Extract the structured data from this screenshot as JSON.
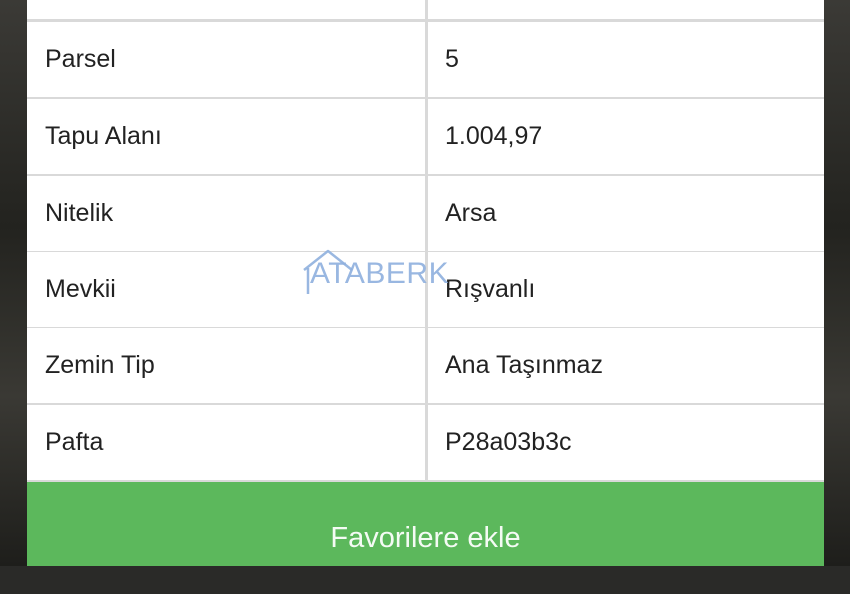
{
  "details": {
    "rows": [
      {
        "label": "",
        "value": ""
      },
      {
        "label": "Parsel",
        "value": "5"
      },
      {
        "label": "Tapu Alanı",
        "value": "1.004,97"
      },
      {
        "label": "Nitelik",
        "value": "Arsa"
      },
      {
        "label": "Mevkii",
        "value": "Rışvanlı"
      },
      {
        "label": "Zemin Tip",
        "value": "Ana Taşınmaz"
      },
      {
        "label": "Pafta",
        "value": "P28a03b3c"
      }
    ]
  },
  "actions": {
    "favorite_label": "Favorilere ekle"
  },
  "watermark": {
    "text": "ATABERK",
    "color": "#8fb0de"
  },
  "colors": {
    "button_green": "#5cb85c",
    "row_background": "#ffffff",
    "divider": "#d9d9d9"
  }
}
